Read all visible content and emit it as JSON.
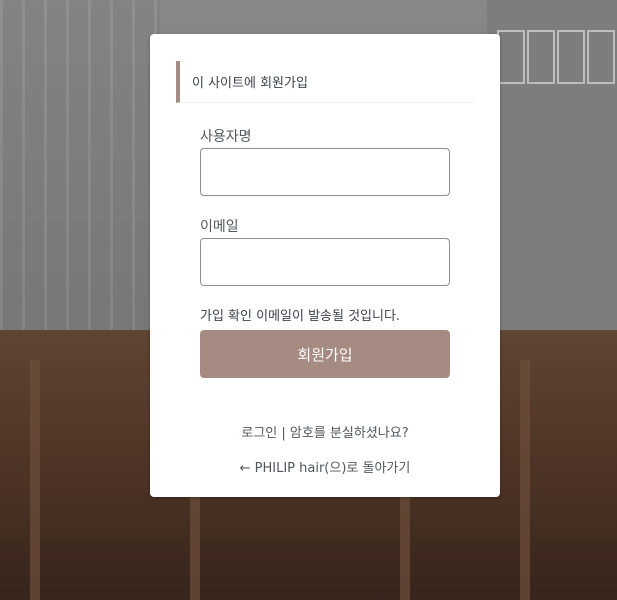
{
  "form": {
    "message": "이 사이트에 회원가입",
    "username_label": "사용자명",
    "username_value": "",
    "email_label": "이메일",
    "email_value": "",
    "note": "가입 확인 이메일이 발송될 것입니다.",
    "submit_label": "회원가입"
  },
  "links": {
    "login": "로그인",
    "separator": " | ",
    "lost_password": "암호를 분실하셨나요?",
    "back_to_site": "← PHILIP hair(으)로 돌아가기"
  },
  "colors": {
    "accent": "#a58b82",
    "card": "#ffffff",
    "text": "#3c434a"
  }
}
